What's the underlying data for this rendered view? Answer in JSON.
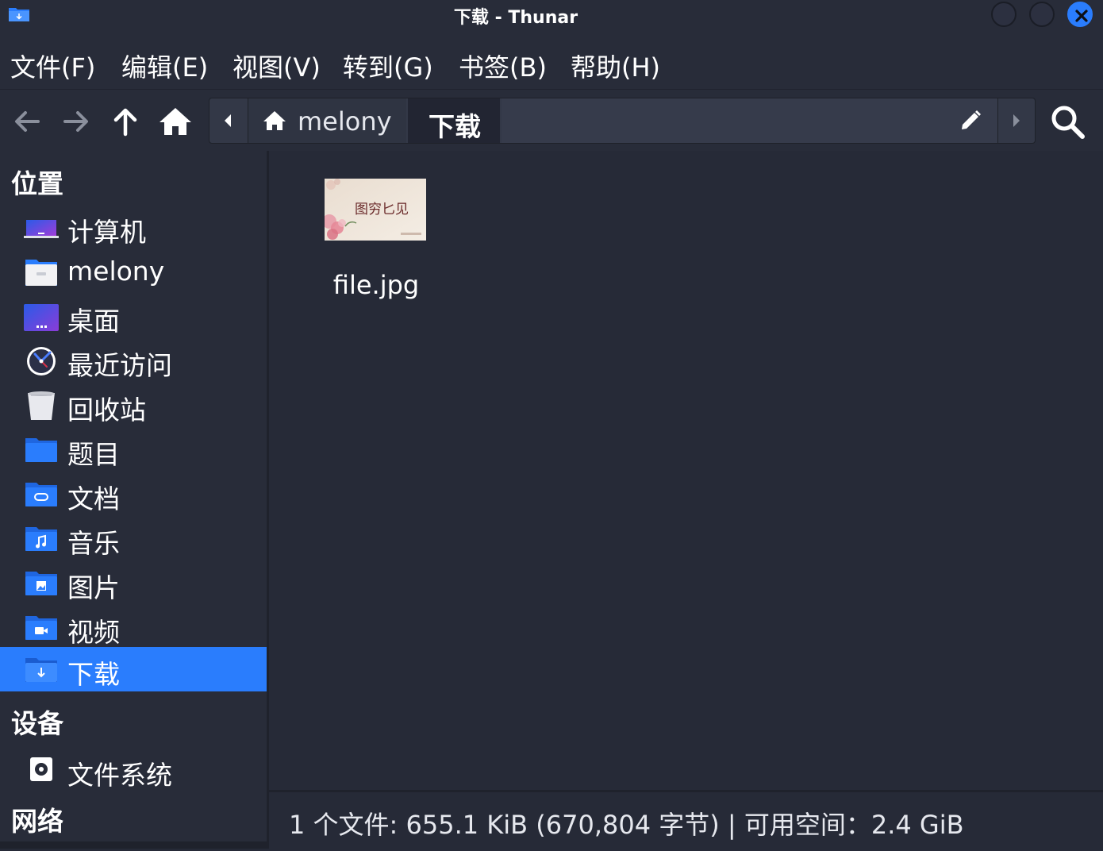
{
  "window": {
    "title": "下载 - Thunar"
  },
  "menu": {
    "items": [
      "文件(F)",
      "编辑(E)",
      "视图(V)",
      "转到(G)",
      "书签(B)",
      "帮助(H)"
    ]
  },
  "toolbar": {
    "back_icon": "arrow-left-icon",
    "forward_icon": "arrow-right-icon",
    "up_icon": "arrow-up-icon",
    "home_icon": "home-icon"
  },
  "pathbar": {
    "home_label": "melony",
    "current_label": "下载"
  },
  "sidebar": {
    "places_title": "位置",
    "places": [
      {
        "label": "计算机",
        "icon": "computer-icon"
      },
      {
        "label": "melony",
        "icon": "home-folder-icon"
      },
      {
        "label": "桌面",
        "icon": "desktop-icon"
      },
      {
        "label": "最近访问",
        "icon": "recent-clock-icon"
      },
      {
        "label": "回收站",
        "icon": "trash-icon"
      },
      {
        "label": "题目",
        "icon": "folder-icon"
      },
      {
        "label": "文档",
        "icon": "documents-folder-icon"
      },
      {
        "label": "音乐",
        "icon": "music-folder-icon"
      },
      {
        "label": "图片",
        "icon": "pictures-folder-icon"
      },
      {
        "label": "视频",
        "icon": "videos-folder-icon"
      },
      {
        "label": "下载",
        "icon": "downloads-folder-icon",
        "selected": true
      }
    ],
    "devices_title": "设备",
    "devices": [
      {
        "label": "文件系统",
        "icon": "drive-icon"
      }
    ],
    "network_title": "网络"
  },
  "files": [
    {
      "name": "file.jpg",
      "thumbnail_text": "图穷匕见"
    }
  ],
  "status": {
    "text": "1 个文件: 655.1 KiB (670,804 字节)  |  可用空间：2.4 GiB"
  },
  "colors": {
    "accent": "#2a7dfd",
    "background": "#262a37",
    "panel": "#282c39"
  }
}
